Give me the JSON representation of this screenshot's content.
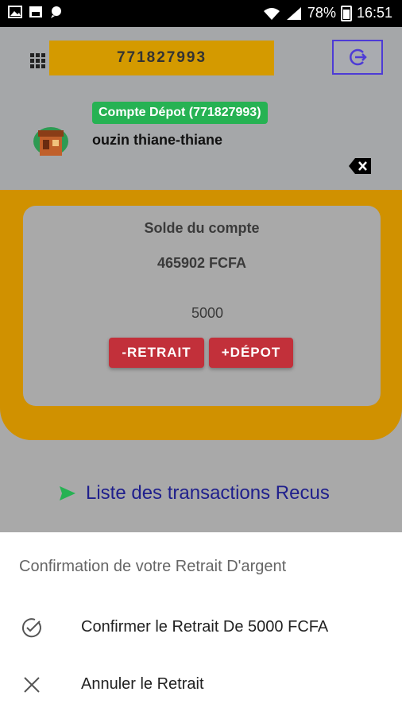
{
  "status_bar": {
    "battery": "78%",
    "time": "16:51"
  },
  "header": {
    "phone_number": "771827993",
    "account_badge": "Compte Dépot (771827993)",
    "account_name": "ouzin thiane-thiane"
  },
  "balance": {
    "title": "Solde du compte",
    "value": "465902 FCFA",
    "amount_input": "5000",
    "withdraw_label": "-RETRAIT",
    "deposit_label": "+DÉPOT"
  },
  "transactions_link": "Liste des transactions Recus",
  "sheet": {
    "title": "Confirmation de votre Retrait D'argent",
    "confirm_label": "Confirmer le Retrait De 5000 FCFA",
    "cancel_label": "Annuler le Retrait"
  },
  "colors": {
    "accent_yellow": "#d09100",
    "badge_green": "#26b253",
    "button_red": "#c2303a",
    "link_blue": "#1f1f8c"
  },
  "icons": [
    "app-grid-icon",
    "logout-icon",
    "shop-avatar-icon",
    "backspace-icon",
    "send-arrow-icon",
    "check-circle-icon",
    "close-icon"
  ]
}
